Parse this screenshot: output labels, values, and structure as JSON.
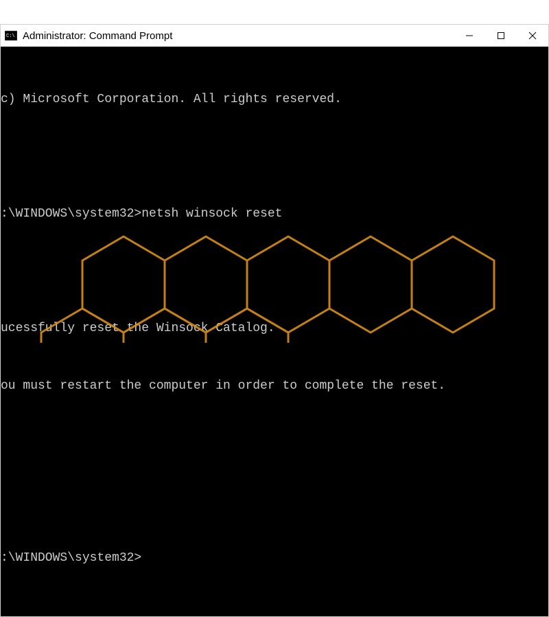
{
  "window": {
    "title": "Administrator: Command Prompt",
    "icon_name": "cmd-icon"
  },
  "terminal": {
    "lines": [
      "c) Microsoft Corporation. All rights reserved.",
      "",
      ":\\WINDOWS\\system32>netsh winsock reset",
      "",
      "ucessfully reset the Winsock Catalog.",
      "ou must restart the computer in order to complete the reset.",
      "",
      "",
      ":\\WINDOWS\\system32>"
    ]
  },
  "colors": {
    "accent": "#f5a623",
    "terminal_bg": "#000000",
    "terminal_fg": "#cccccc"
  }
}
